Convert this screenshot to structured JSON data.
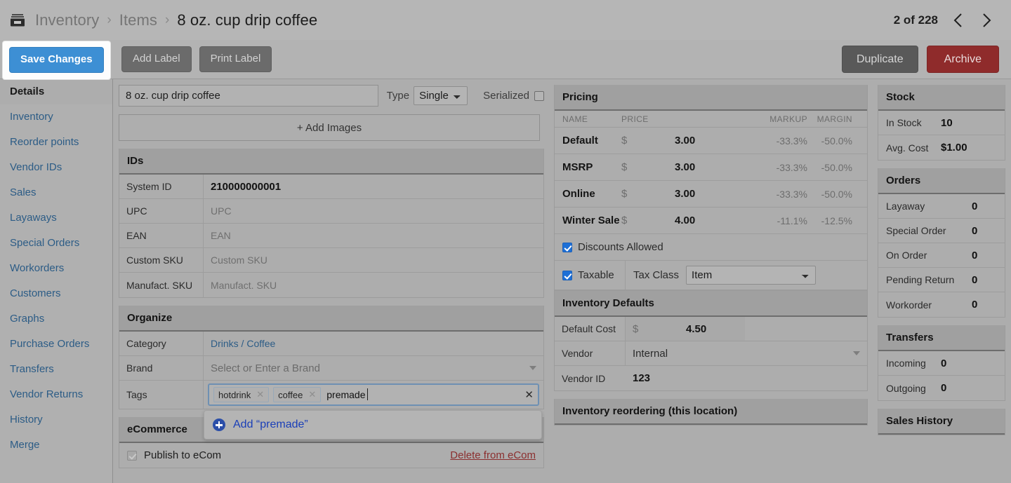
{
  "breadcrumb": {
    "icon": "archive-box-icon",
    "items": [
      "Inventory",
      "Items",
      "8 oz. cup drip coffee"
    ],
    "separator": "›"
  },
  "pager": {
    "count_label": "2 of 228",
    "prev_icon": "chevron-left-icon",
    "next_icon": "chevron-right-icon"
  },
  "toolbar": {
    "save_label": "Save Changes",
    "add_label": "Add Label",
    "print_label": "Print Label",
    "duplicate_label": "Duplicate",
    "archive_label": "Archive"
  },
  "sidebar": {
    "items": [
      {
        "label": "Details",
        "active": true
      },
      {
        "label": "Inventory",
        "active": false
      },
      {
        "label": "Reorder points",
        "active": false
      },
      {
        "label": "Vendor IDs",
        "active": false
      },
      {
        "label": "Sales",
        "active": false
      },
      {
        "label": "Layaways",
        "active": false
      },
      {
        "label": "Special Orders",
        "active": false
      },
      {
        "label": "Workorders",
        "active": false
      },
      {
        "label": "Customers",
        "active": false
      },
      {
        "label": "Graphs",
        "active": false
      },
      {
        "label": "Purchase Orders",
        "active": false
      },
      {
        "label": "Transfers",
        "active": false
      },
      {
        "label": "Vendor Returns",
        "active": false
      },
      {
        "label": "History",
        "active": false
      },
      {
        "label": "Merge",
        "active": false
      }
    ]
  },
  "item": {
    "name_value": "8 oz. cup drip coffee",
    "type_label": "Type",
    "type_value": "Single",
    "serialized_label": "Serialized",
    "serialized_checked": false,
    "add_images_label": "+ Add Images"
  },
  "ids": {
    "title": "IDs",
    "rows": [
      {
        "label": "System ID",
        "value": "210000000001",
        "strong": true
      },
      {
        "label": "UPC",
        "value": "UPC",
        "placeholder": true
      },
      {
        "label": "EAN",
        "value": "EAN",
        "placeholder": true
      },
      {
        "label": "Custom SKU",
        "value": "Custom SKU",
        "placeholder": true
      },
      {
        "label": "Manufact. SKU",
        "value": "Manufact. SKU",
        "placeholder": true
      }
    ]
  },
  "organize": {
    "title": "Organize",
    "category_label": "Category",
    "category_value": "Drinks / Coffee",
    "brand_label": "Brand",
    "brand_placeholder": "Select or Enter a Brand",
    "tags_label": "Tags",
    "tags": [
      "hotdrink",
      "coffee"
    ],
    "tags_input_value": "premade",
    "tags_clear_icon": "clear-icon",
    "suggestion_label": "Add “premade”",
    "suggestion_icon": "plus-circle-icon"
  },
  "ecommerce": {
    "title": "eCommerce",
    "publish_label": "Publish to eCom",
    "publish_checked": true,
    "delete_label": "Delete from eCom"
  },
  "pricing": {
    "title": "Pricing",
    "columns": [
      "NAME",
      "PRICE",
      "MARKUP",
      "MARGIN"
    ],
    "currency": "$",
    "rows": [
      {
        "name": "Default",
        "price": "3.00",
        "markup": "-33.3%",
        "margin": "-50.0%"
      },
      {
        "name": "MSRP",
        "price": "3.00",
        "markup": "-33.3%",
        "margin": "-50.0%"
      },
      {
        "name": "Online",
        "price": "3.00",
        "markup": "-33.3%",
        "margin": "-50.0%"
      },
      {
        "name": "Winter Sale",
        "price": "4.00",
        "markup": "-11.1%",
        "margin": "-12.5%"
      }
    ],
    "discounts_label": "Discounts Allowed",
    "discounts_checked": true,
    "taxable_label": "Taxable",
    "taxable_checked": true,
    "tax_class_label": "Tax Class",
    "tax_class_value": "Item"
  },
  "inventory_defaults": {
    "title": "Inventory Defaults",
    "default_cost_label": "Default Cost",
    "default_cost_currency": "$",
    "default_cost_value": "4.50",
    "vendor_label": "Vendor",
    "vendor_value": "Internal",
    "vendor_id_label": "Vendor ID",
    "vendor_id_value": "123"
  },
  "reordering": {
    "title": "Inventory reordering (this location)"
  },
  "stock": {
    "title": "Stock",
    "rows": [
      {
        "label": "In Stock",
        "value": "10"
      },
      {
        "label": "Avg. Cost",
        "value": "$1.00"
      }
    ]
  },
  "orders": {
    "title": "Orders",
    "rows": [
      {
        "label": "Layaway",
        "value": "0"
      },
      {
        "label": "Special Order",
        "value": "0"
      },
      {
        "label": "On Order",
        "value": "0"
      },
      {
        "label": "Pending Return",
        "value": "0"
      },
      {
        "label": "Workorder",
        "value": "0"
      }
    ]
  },
  "transfers": {
    "title": "Transfers",
    "rows": [
      {
        "label": "Incoming",
        "value": "0"
      },
      {
        "label": "Outgoing",
        "value": "0"
      }
    ]
  },
  "sales_history": {
    "title": "Sales History"
  },
  "colors": {
    "accent_blue": "#3d8fd4",
    "link_blue": "#2c5c86",
    "danger_red": "#8f2b2b",
    "page_bg": "#adadad",
    "panel_head": "#a0a0a0"
  }
}
